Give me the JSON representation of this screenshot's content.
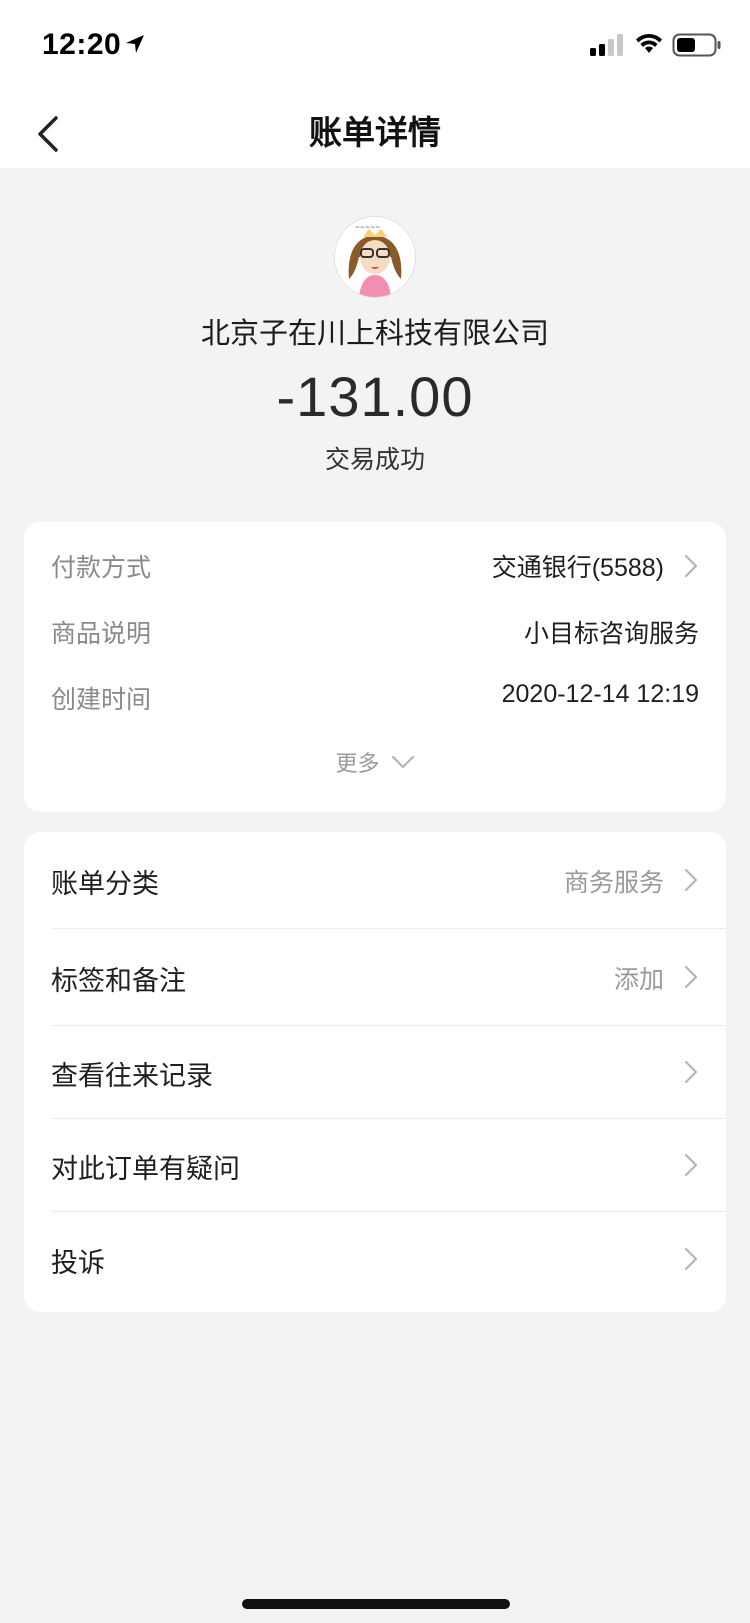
{
  "status_bar": {
    "time": "12:20"
  },
  "nav": {
    "title": "账单详情"
  },
  "header": {
    "merchant": "北京子在川上科技有限公司",
    "amount": "-131.00",
    "status": "交易成功"
  },
  "details": {
    "rows": [
      {
        "label": "付款方式",
        "value": "交通银行(5588)"
      },
      {
        "label": "商品说明",
        "value": "小目标咨询服务"
      },
      {
        "label": "创建时间",
        "value": "2020-12-14 12:19"
      }
    ],
    "more_label": "更多"
  },
  "actions": [
    {
      "label": "账单分类",
      "value": "商务服务"
    },
    {
      "label": "标签和备注",
      "value": "添加"
    },
    {
      "label": "查看往来记录",
      "value": ""
    },
    {
      "label": "对此订单有疑问",
      "value": ""
    },
    {
      "label": "投诉",
      "value": ""
    }
  ]
}
